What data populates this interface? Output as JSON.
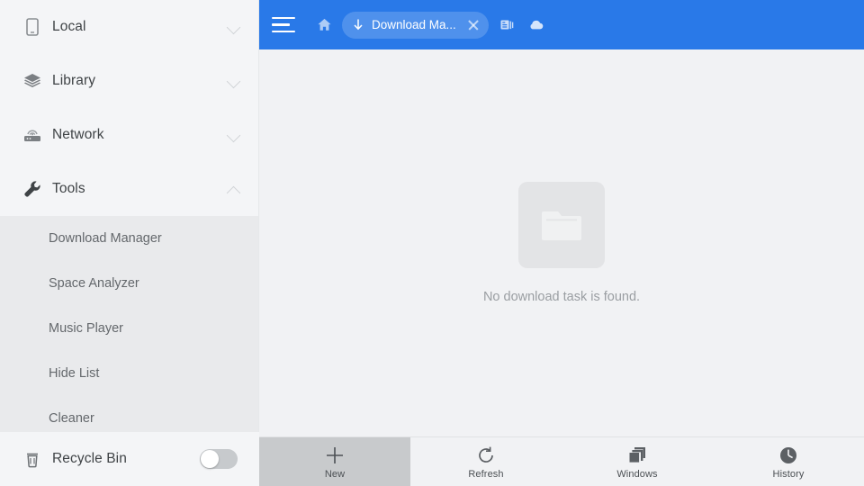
{
  "sidebar": {
    "nav": [
      {
        "label": "Local",
        "icon": "phone-icon",
        "chevron": "down",
        "expanded": false
      },
      {
        "label": "Library",
        "icon": "layers-icon",
        "chevron": "down",
        "expanded": false
      },
      {
        "label": "Network",
        "icon": "router-icon",
        "chevron": "down",
        "expanded": false
      },
      {
        "label": "Tools",
        "icon": "wrench-icon",
        "chevron": "up",
        "expanded": true
      }
    ],
    "submenu": [
      {
        "label": "Download Manager"
      },
      {
        "label": "Space Analyzer"
      },
      {
        "label": "Music Player"
      },
      {
        "label": "Hide List"
      },
      {
        "label": "Cleaner"
      }
    ],
    "footer": {
      "label": "Recycle Bin",
      "icon": "trash-icon",
      "toggle_state": "off"
    }
  },
  "topbar": {
    "menu_icon": "hamburger-icon",
    "home_icon": "home-icon",
    "tab": {
      "icon": "download-arrow-icon",
      "title": "Download Ma...",
      "close_icon": "close-icon"
    },
    "icons": [
      {
        "name": "window-cards-icon"
      },
      {
        "name": "cloud-icon"
      }
    ],
    "accent_color": "#2979e8"
  },
  "content": {
    "empty_icon": "folder-icon",
    "empty_message": "No download task is found."
  },
  "bottombar": {
    "items": [
      {
        "label": "New",
        "icon": "plus-icon",
        "active": true
      },
      {
        "label": "Refresh",
        "icon": "refresh-icon",
        "active": false
      },
      {
        "label": "Windows",
        "icon": "windows-stack-icon",
        "active": false
      },
      {
        "label": "History",
        "icon": "clock-icon",
        "active": false
      }
    ]
  }
}
